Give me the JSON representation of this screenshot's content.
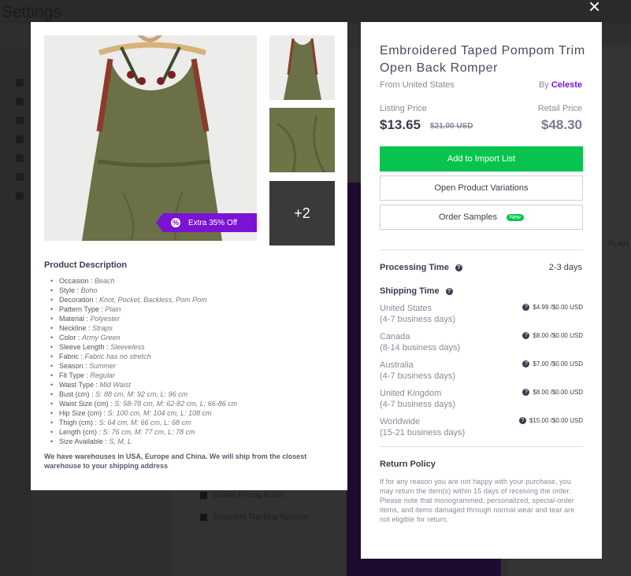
{
  "background": {
    "page_title": "Settings",
    "snippets": [
      "Global Pricing Rules",
      "Shipment Tracking Number",
      "PLAN"
    ]
  },
  "product": {
    "title": "Embroidered Taped Pompom Trim Open Back Romper",
    "from": "From United States",
    "by_prefix": "By",
    "supplier": "Celeste",
    "listing_label": "Listing Price",
    "retail_label": "Retail Price",
    "listing_price": "$13.65",
    "old_price": "$21.00 USD",
    "retail_price": "$48.30",
    "discount": "Extra 35% Off",
    "more_images": "+2"
  },
  "buttons": {
    "add_to_import": "Add to Import List",
    "open_variations": "Open Product Variations",
    "order_samples": "Order Samples",
    "new_tag": "New"
  },
  "processing": {
    "label": "Processing Time",
    "value": "2-3 days"
  },
  "shipping": {
    "label": "Shipping Time",
    "rows": [
      {
        "country": "United States",
        "days": "(4-7 business days)",
        "cost": "$4.99 /$0.00 USD"
      },
      {
        "country": "Canada",
        "days": "(8-14 business days)",
        "cost": "$8.00 /$0.00 USD"
      },
      {
        "country": "Australia",
        "days": "(4-7 business days)",
        "cost": "$7.00 /$0.00 USD"
      },
      {
        "country": "United Kingdom",
        "days": "(4-7 business days)",
        "cost": "$8.00 /$0.00 USD"
      },
      {
        "country": "Worldwide",
        "days": "(15-21 business days)",
        "cost": "$15.00 /$0.00 USD"
      }
    ]
  },
  "return_policy": {
    "label": "Return Policy",
    "text": "If for any reason you are not happy with your purchase, you may return the item(s) within 15 days of receiving the order. Please note that monogrammed, personalized, special-order items, and items damaged through normal wear and tear are not eligible for return."
  },
  "description": {
    "title": "Product Description",
    "items": [
      {
        "key": "Occasion",
        "value": "Beach"
      },
      {
        "key": "Style",
        "value": "Boho"
      },
      {
        "key": "Decoration",
        "value": "Knot, Pocket, Backless, Pom Pom"
      },
      {
        "key": "Pattern Type",
        "value": "Plain"
      },
      {
        "key": "Material",
        "value": "Polyester"
      },
      {
        "key": "Neckline",
        "value": "Straps"
      },
      {
        "key": "Color",
        "value": "Army Green"
      },
      {
        "key": "Sleeve Length",
        "value": "Sleeveless"
      },
      {
        "key": "Fabric",
        "value": "Fabric has no stretch"
      },
      {
        "key": "Season",
        "value": "Summer"
      },
      {
        "key": "Fit Type",
        "value": "Regular"
      },
      {
        "key": "Waist Type",
        "value": "Mid Waist"
      },
      {
        "key": "Bust (cm)",
        "value": "S: 88 cm, M: 92 cm, L: 96 cm"
      },
      {
        "key": "Waist Size (cm)",
        "value": "S: 58-78 cm, M: 62-82 cm, L: 66-86 cm"
      },
      {
        "key": "Hip Size (cm)",
        "value": "S: 100 cm, M: 104 cm, L: 108 cm"
      },
      {
        "key": "Thigh (cm)",
        "value": "S: 64 cm, M: 66 cm, L: 68 cm"
      },
      {
        "key": "Length (cm)",
        "value": "S: 76 cm, M: 77 cm, L: 78 cm"
      },
      {
        "key": "Size Available",
        "value": "S, M, L"
      }
    ],
    "warehouse_note": "We have warehouses in USA, Europe and China. We will ship from the closest warehouse to your shipping address"
  },
  "icons": {
    "close": "close-icon",
    "discount": "percent-badge-icon",
    "help": "help-icon"
  },
  "colors": {
    "accent_purple": "#7b12d4",
    "primary_green": "#08c44f",
    "dress_green": "#6b7046"
  }
}
